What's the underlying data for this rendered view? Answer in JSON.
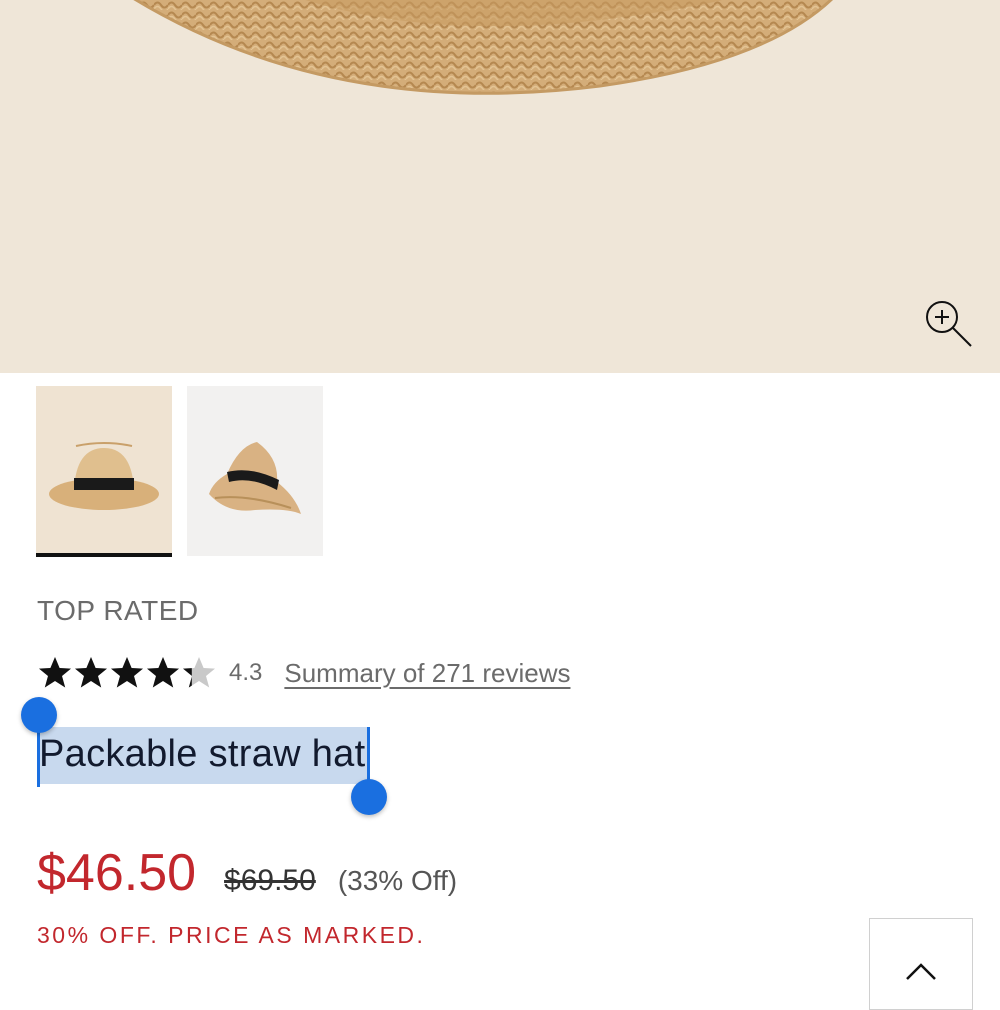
{
  "gallery": {
    "zoom_icon": "zoom-in-icon",
    "thumbnails": [
      {
        "alt": "hat-front-thumbnail",
        "selected": true
      },
      {
        "alt": "hat-folded-thumbnail",
        "selected": false
      }
    ]
  },
  "product": {
    "badge": "TOP RATED",
    "rating": {
      "stars": 4.3,
      "value_label": "4.3",
      "reviews_link": "Summary of 271 reviews"
    },
    "title": "Packable straw hat",
    "price": {
      "sale": "$46.50",
      "original": "$69.50",
      "discount": "(33% Off)"
    },
    "promo": "30% OFF. PRICE AS MARKED."
  },
  "colors": {
    "sale_red": "#c2272d",
    "selection_blue": "#1a6fe0",
    "hero_bg": "#efe6d8"
  },
  "back_to_top_icon": "chevron-up-icon"
}
